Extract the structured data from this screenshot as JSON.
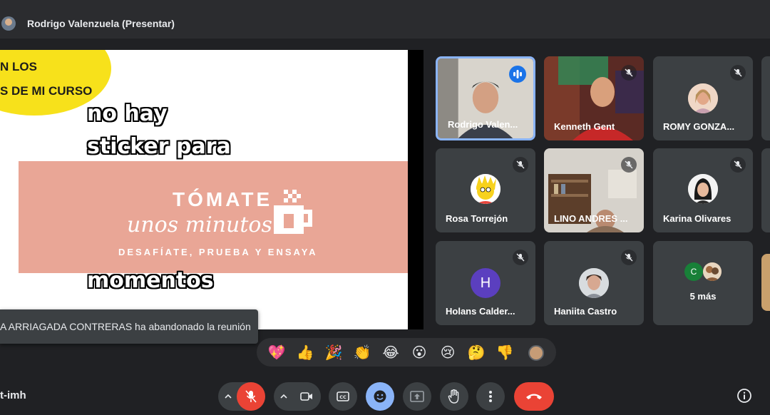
{
  "presenter": {
    "name": "Rodrigo Valenzuela (Presentar)"
  },
  "slide": {
    "blob_lines": [
      "N LOS",
      "S DE MI CURSO"
    ],
    "sticker_lines": [
      "no hay",
      "sticker para",
      "momentos"
    ],
    "brand_title": "TÓMATE",
    "brand_subtitle": "unos minutos",
    "brand_tagline": "DESAFÍATE, PRUEBA Y ENSAYA"
  },
  "toast": {
    "text": "A ARRIAGADA CONTRERAS ha abandonado la reunión"
  },
  "tiles": [
    {
      "name": "Rodrigo Valen...",
      "initial": ""
    },
    {
      "name": "Kenneth Gent",
      "initial": ""
    },
    {
      "name": "ROMY GONZA...",
      "initial": ""
    },
    {
      "name": "Rosa Torrejón",
      "initial": ""
    },
    {
      "name": "LINO ANDRES ...",
      "initial": ""
    },
    {
      "name": "Karina Olivares",
      "initial": ""
    },
    {
      "name": "Holans Calder...",
      "initial": "H"
    },
    {
      "name": "Haniita Castro",
      "initial": ""
    },
    {
      "name": "5 más",
      "initial": "C"
    }
  ],
  "reactions": [
    "💖",
    "👍",
    "🎉",
    "👏",
    "😂",
    "😮",
    "😢",
    "🤔",
    "👎"
  ],
  "footer": {
    "meeting_code": "t-imh"
  },
  "colors": {
    "accent": "#8ab4f8",
    "danger": "#ea4335",
    "panel": "#3c4043",
    "background": "#202124"
  }
}
